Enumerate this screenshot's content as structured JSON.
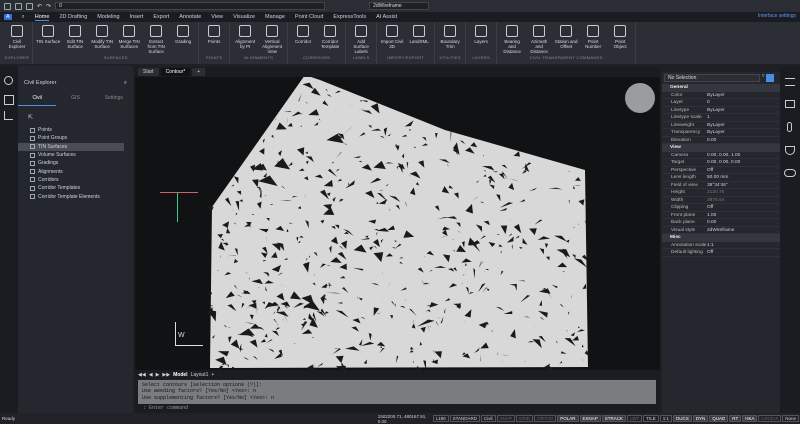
{
  "quick_access": {
    "layer_value": "0",
    "visual_style": "2dWireframe"
  },
  "ribbon_tabs": [
    "Home",
    "2D Drafting",
    "Modeling",
    "Insert",
    "Export",
    "Annotate",
    "View",
    "Visualize",
    "Manage",
    "Point Cloud",
    "ExpressTools",
    "AI Assist"
  ],
  "interface_settings": "Interface settings",
  "ribbon_groups": [
    {
      "label": "EXPLORER",
      "buttons": [
        "Civil Explorer"
      ]
    },
    {
      "label": "SURFACES",
      "buttons": [
        "TIN Surface",
        "Edit TIN Surface",
        "Modify TIN Surface",
        "Merge TIN Surfaces",
        "Extract from TIN Surface",
        "Grading"
      ]
    },
    {
      "label": "POINTS",
      "buttons": [
        "Points"
      ]
    },
    {
      "label": "ALIGNMENTS",
      "buttons": [
        "Alignment by PI",
        "Vertical Alignment View"
      ]
    },
    {
      "label": "CORRIDORS",
      "buttons": [
        "Corridor",
        "Corridor Template"
      ]
    },
    {
      "label": "LABELS",
      "buttons": [
        "Add Surface Labels"
      ]
    },
    {
      "label": "IMPORT/EXPORT",
      "buttons": [
        "Import Civil 3D",
        "LandXML"
      ]
    },
    {
      "label": "UTILITIES",
      "buttons": [
        "Boundary Trim"
      ]
    },
    {
      "label": "LAYERS",
      "buttons": [
        "Layers"
      ]
    },
    {
      "label": "CIVIL TRANSPARENT COMMANDS",
      "buttons": [
        "Bearing and Distance",
        "Azimuth and Distance",
        "Station and Offset",
        "Point Number",
        "Point Object"
      ]
    }
  ],
  "explorer": {
    "title": "Civil Explorer",
    "tabs": [
      "Civil",
      "GIS",
      "Settings"
    ],
    "items": [
      "Points",
      "Point Groups",
      "TIN Surfaces",
      "Volume Surfaces",
      "Gradings",
      "Alignments",
      "Corridors",
      "Corridor Templates",
      "Corridor Template Elements"
    ],
    "selected_index": 2
  },
  "doc_tabs": [
    "Start",
    "Contour*"
  ],
  "layout_tabs": [
    "Model",
    "Layout1"
  ],
  "properties": {
    "selection": "No Selection",
    "sections": [
      {
        "title": "General",
        "rows": [
          [
            "Color",
            "ByLayer"
          ],
          [
            "Layer",
            "0"
          ],
          [
            "Linetype",
            "ByLayer"
          ],
          [
            "Linetype scale",
            "1"
          ],
          [
            "Lineweight",
            "ByLayer"
          ],
          [
            "Transparency",
            "ByLayer"
          ],
          [
            "Elevation",
            "0.00"
          ]
        ]
      },
      {
        "title": "View",
        "rows": [
          [
            "Camera",
            "0.00, 0.00, 1.00"
          ],
          [
            "Target",
            "0.00, 0.00, 0.00"
          ],
          [
            "Perspective",
            "Off"
          ],
          [
            "Lens length",
            "50.00 mm"
          ],
          [
            "Field of view",
            "38°34'46\""
          ],
          [
            "Height",
            "2120.75"
          ],
          [
            "Width",
            "3875.64"
          ],
          [
            "Clipping",
            "Off"
          ],
          [
            "Front plane",
            "1.00"
          ],
          [
            "Back plane",
            "0.00"
          ],
          [
            "Visual style",
            "2dWireframe"
          ]
        ]
      },
      {
        "title": "Misc",
        "rows": [
          [
            "Annotation scale",
            "1:1"
          ],
          [
            "Default lighting",
            "Off"
          ]
        ]
      }
    ]
  },
  "command": {
    "lines": [
      "Select contours [selection options (?)]:",
      "Use weeding factors?  [Yes/No] <Yes>: n",
      "Use supplementing factors?  [Yes/No] <Yes>: n"
    ],
    "prompt": ": Enter command"
  },
  "status": {
    "ready": "Ready",
    "coords": "1502200.71, 480167.91, 0.00",
    "items": [
      "L180",
      "STANDARD",
      "Civil",
      "SNAP",
      "GRID",
      "ORTHO",
      "POLAR",
      "ESNAP",
      "STRACK",
      "LWT",
      "TILE",
      "1:1",
      "DUCS",
      "DYN",
      "QUAD",
      "RT",
      "HKA",
      "LOCKUI",
      "None"
    ],
    "on": [
      "POLAR",
      "ESNAP",
      "STRACK",
      "DUCS",
      "DYN",
      "QUAD",
      "RT",
      "HKA"
    ],
    "off": [
      "SNAP",
      "GRID",
      "ORTHO",
      "LWT",
      "LOCKUI"
    ]
  }
}
